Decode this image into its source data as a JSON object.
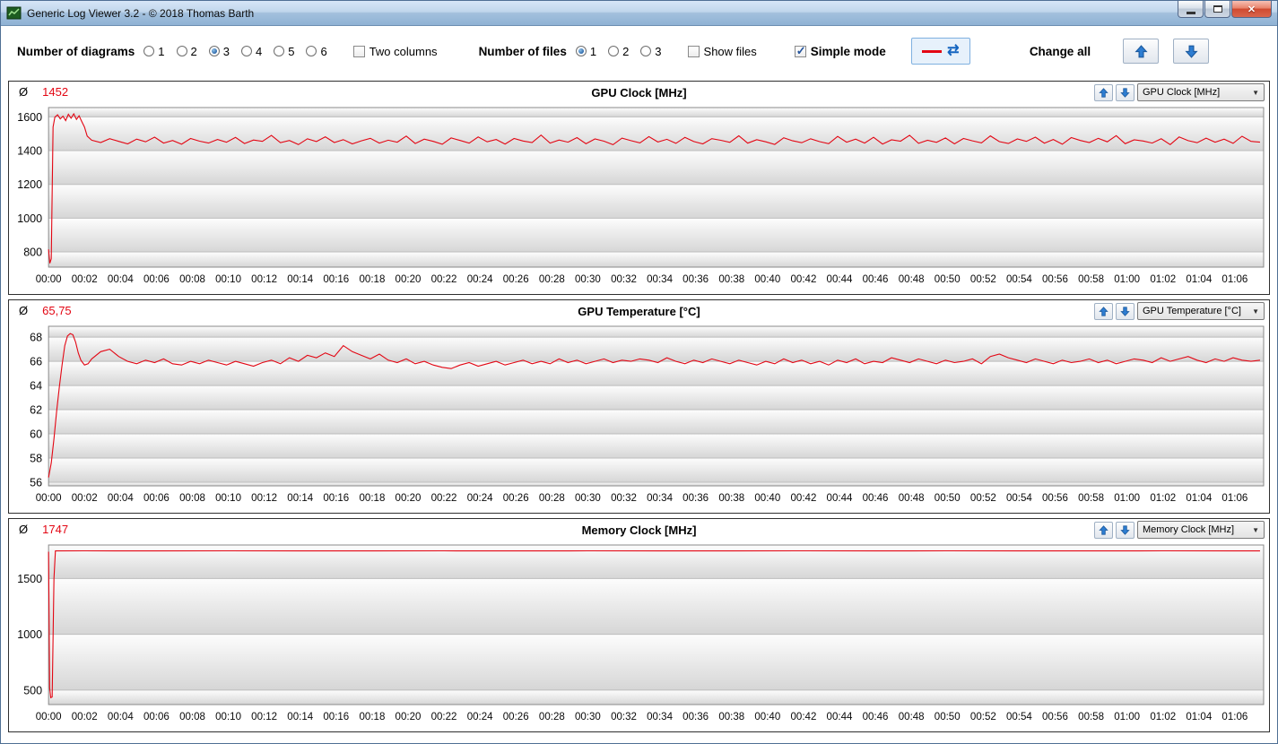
{
  "window": {
    "title": "Generic Log Viewer 3.2 - © 2018 Thomas Barth"
  },
  "toolbar": {
    "diagrams_label": "Number of diagrams",
    "diagram_options": [
      "1",
      "2",
      "3",
      "4",
      "5",
      "6"
    ],
    "diagrams_selected": "3",
    "two_columns_label": "Two columns",
    "two_columns_checked": false,
    "files_label": "Number of files",
    "file_options": [
      "1",
      "2",
      "3"
    ],
    "files_selected": "1",
    "show_files_label": "Show files",
    "show_files_checked": false,
    "simple_mode_label": "Simple mode",
    "simple_mode_checked": true,
    "change_all_label": "Change all"
  },
  "time_axis": {
    "labels": [
      "00:00",
      "00:02",
      "00:04",
      "00:06",
      "00:08",
      "00:10",
      "00:12",
      "00:14",
      "00:16",
      "00:18",
      "00:20",
      "00:22",
      "00:24",
      "00:26",
      "00:28",
      "00:30",
      "00:32",
      "00:34",
      "00:36",
      "00:38",
      "00:40",
      "00:42",
      "00:44",
      "00:46",
      "00:48",
      "00:50",
      "00:52",
      "00:54",
      "00:56",
      "00:58",
      "01:00",
      "01:02",
      "01:04",
      "01:06"
    ],
    "tick_interval_min": 2,
    "xlim": [
      0,
      67.6
    ]
  },
  "charts": [
    {
      "id": "gpu-clock",
      "avg_symbol": "Ø",
      "average": "1452",
      "title": "GPU Clock [MHz]",
      "dropdown_value": "GPU Clock [MHz]",
      "type": "line",
      "line_color": "#e30613",
      "ylim": [
        710,
        1655
      ],
      "yticks": [
        800,
        1000,
        1200,
        1400,
        1600
      ],
      "series": {
        "points": [
          [
            0,
            815
          ],
          [
            0.07,
            733
          ],
          [
            0.15,
            760
          ],
          [
            0.25,
            1540
          ],
          [
            0.35,
            1598
          ],
          [
            0.5,
            1612
          ],
          [
            0.65,
            1588
          ],
          [
            0.8,
            1604
          ],
          [
            0.95,
            1578
          ],
          [
            1.1,
            1615
          ],
          [
            1.25,
            1592
          ],
          [
            1.4,
            1618
          ],
          [
            1.55,
            1585
          ],
          [
            1.7,
            1606
          ],
          [
            1.85,
            1572
          ],
          [
            2.0,
            1540
          ],
          [
            2.15,
            1486
          ]
        ],
        "steady": {
          "start": 2.4,
          "step": 0.5,
          "values": [
            1462,
            1448,
            1471,
            1455,
            1440,
            1468,
            1452,
            1480,
            1445,
            1460,
            1438,
            1472,
            1456,
            1445,
            1466,
            1450,
            1478,
            1442,
            1463,
            1455,
            1490,
            1447,
            1460,
            1436,
            1470,
            1454,
            1482,
            1448,
            1465,
            1440,
            1458,
            1473,
            1445,
            1462,
            1450,
            1486,
            1442,
            1468,
            1455,
            1438,
            1475,
            1460,
            1444,
            1481,
            1452,
            1466,
            1439,
            1472,
            1457,
            1448,
            1492,
            1445,
            1463,
            1450,
            1477,
            1441,
            1469,
            1456,
            1435,
            1474,
            1459,
            1446,
            1483,
            1451,
            1467,
            1443,
            1478,
            1454,
            1440,
            1471,
            1461,
            1449,
            1488,
            1444,
            1465,
            1452,
            1437,
            1476,
            1458,
            1447,
            1470,
            1453,
            1441,
            1484,
            1450,
            1468,
            1445,
            1479,
            1439,
            1464,
            1456,
            1491,
            1443,
            1461,
            1449,
            1475,
            1440,
            1472,
            1458,
            1446,
            1487,
            1453,
            1442,
            1469,
            1455,
            1480,
            1444,
            1466,
            1438,
            1477,
            1460,
            1448,
            1473,
            1452,
            1489,
            1441,
            1464,
            1457,
            1445,
            1470,
            1436,
            1481,
            1459,
            1447,
            1474,
            1450,
            1468,
            1443,
            1485,
            1455,
            1450
          ]
        }
      }
    },
    {
      "id": "gpu-temperature",
      "avg_symbol": "Ø",
      "average": "65,75",
      "title": "GPU Temperature [°C]",
      "dropdown_value": "GPU Temperature [°C]",
      "type": "line",
      "line_color": "#e30613",
      "ylim": [
        55.7,
        68.9
      ],
      "yticks": [
        56,
        58,
        60,
        62,
        64,
        66,
        68
      ],
      "series": {
        "points": [
          [
            0,
            56.4
          ],
          [
            0.15,
            57.6
          ],
          [
            0.3,
            59.6
          ],
          [
            0.45,
            61.9
          ],
          [
            0.6,
            63.9
          ],
          [
            0.75,
            65.7
          ],
          [
            0.9,
            67.3
          ],
          [
            1.05,
            68.1
          ],
          [
            1.2,
            68.3
          ],
          [
            1.35,
            68.2
          ],
          [
            1.5,
            67.6
          ],
          [
            1.65,
            66.7
          ],
          [
            1.8,
            66.1
          ],
          [
            2.0,
            65.7
          ],
          [
            2.2,
            65.8
          ]
        ],
        "steady": {
          "start": 2.4,
          "step": 0.5,
          "values": [
            66.2,
            66.8,
            67.0,
            66.4,
            66.0,
            65.8,
            66.1,
            65.9,
            66.2,
            65.8,
            65.7,
            66.0,
            65.8,
            66.1,
            65.9,
            65.7,
            66.0,
            65.8,
            65.6,
            65.9,
            66.1,
            65.8,
            66.3,
            66.0,
            66.5,
            66.3,
            66.7,
            66.4,
            67.3,
            66.8,
            66.5,
            66.2,
            66.6,
            66.1,
            65.9,
            66.2,
            65.8,
            66.0,
            65.7,
            65.5,
            65.4,
            65.7,
            65.9,
            65.6,
            65.8,
            66.0,
            65.7,
            65.9,
            66.1,
            65.8,
            66.0,
            65.8,
            66.2,
            65.9,
            66.1,
            65.8,
            66.0,
            66.2,
            65.9,
            66.1,
            66.0,
            66.2,
            66.1,
            65.9,
            66.3,
            66.0,
            65.8,
            66.1,
            65.9,
            66.2,
            66.0,
            65.8,
            66.1,
            65.9,
            65.7,
            66.0,
            65.8,
            66.2,
            65.9,
            66.1,
            65.8,
            66.0,
            65.7,
            66.1,
            65.9,
            66.2,
            65.8,
            66.0,
            65.9,
            66.3,
            66.1,
            65.9,
            66.2,
            66.0,
            65.8,
            66.1,
            65.9,
            66.0,
            66.2,
            65.8,
            66.4,
            66.6,
            66.3,
            66.1,
            65.9,
            66.2,
            66.0,
            65.8,
            66.1,
            65.9,
            66.0,
            66.2,
            65.9,
            66.1,
            65.8,
            66.0,
            66.2,
            66.1,
            65.9,
            66.3,
            66.0,
            66.2,
            66.4,
            66.1,
            65.9,
            66.2,
            66.0,
            66.3,
            66.1,
            66.0,
            66.1
          ]
        }
      }
    },
    {
      "id": "memory-clock",
      "avg_symbol": "Ø",
      "average": "1747",
      "title": "Memory Clock [MHz]",
      "dropdown_value": "Memory Clock [MHz]",
      "type": "line",
      "line_color": "#e30613",
      "ylim": [
        370,
        1800
      ],
      "yticks": [
        500,
        1000,
        1500
      ],
      "series": {
        "points": [
          [
            0,
            1740
          ],
          [
            0.06,
            520
          ],
          [
            0.12,
            432
          ],
          [
            0.2,
            438
          ],
          [
            0.3,
            1500
          ],
          [
            0.38,
            1747
          ],
          [
            2,
            1748
          ],
          [
            6,
            1747
          ],
          [
            10,
            1748
          ],
          [
            14,
            1747
          ],
          [
            18,
            1747
          ],
          [
            22,
            1748
          ],
          [
            26,
            1747
          ],
          [
            30,
            1748
          ],
          [
            34,
            1747
          ],
          [
            38,
            1747
          ],
          [
            42,
            1748
          ],
          [
            46,
            1747
          ],
          [
            50,
            1748
          ],
          [
            54,
            1747
          ],
          [
            58,
            1747
          ],
          [
            62,
            1748
          ],
          [
            66,
            1747
          ],
          [
            67.4,
            1747
          ]
        ]
      }
    }
  ]
}
